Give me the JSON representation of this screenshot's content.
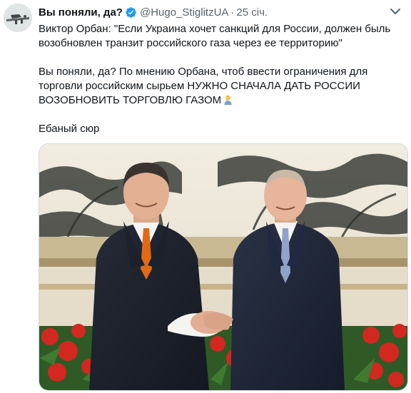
{
  "author": {
    "name": "Вы поняли, да?",
    "handle": "@Hugo_StiglitzUA",
    "separator": "·",
    "time": "25 січ."
  },
  "icons": {
    "avatar": "avatar-image",
    "verified": "verified-badge-icon",
    "more": "chevron-down-icon",
    "emoji": "person-facepalming-emoji"
  },
  "colors": {
    "verified": "#1d9bf0",
    "text": "#0f1419",
    "secondary": "#536471"
  },
  "tweet": {
    "paragraph1": "Виктор Орбан: \"Если Украина хочет санкций для России, должен быль возобновлен транзит российского газа через ее территорию\"",
    "paragraph2": "Вы поняли, да? По мнению Орбана, чтоб ввести ограничения для торговли российским сырьем НУЖНО СНАЧАЛА ДАТЬ РОССИИ ВОЗОБНОВИТЬ ТОРГОВЛЮ ГАЗОМ",
    "paragraph3": "Ебаный сюр"
  },
  "media": {
    "kind": "photo"
  }
}
